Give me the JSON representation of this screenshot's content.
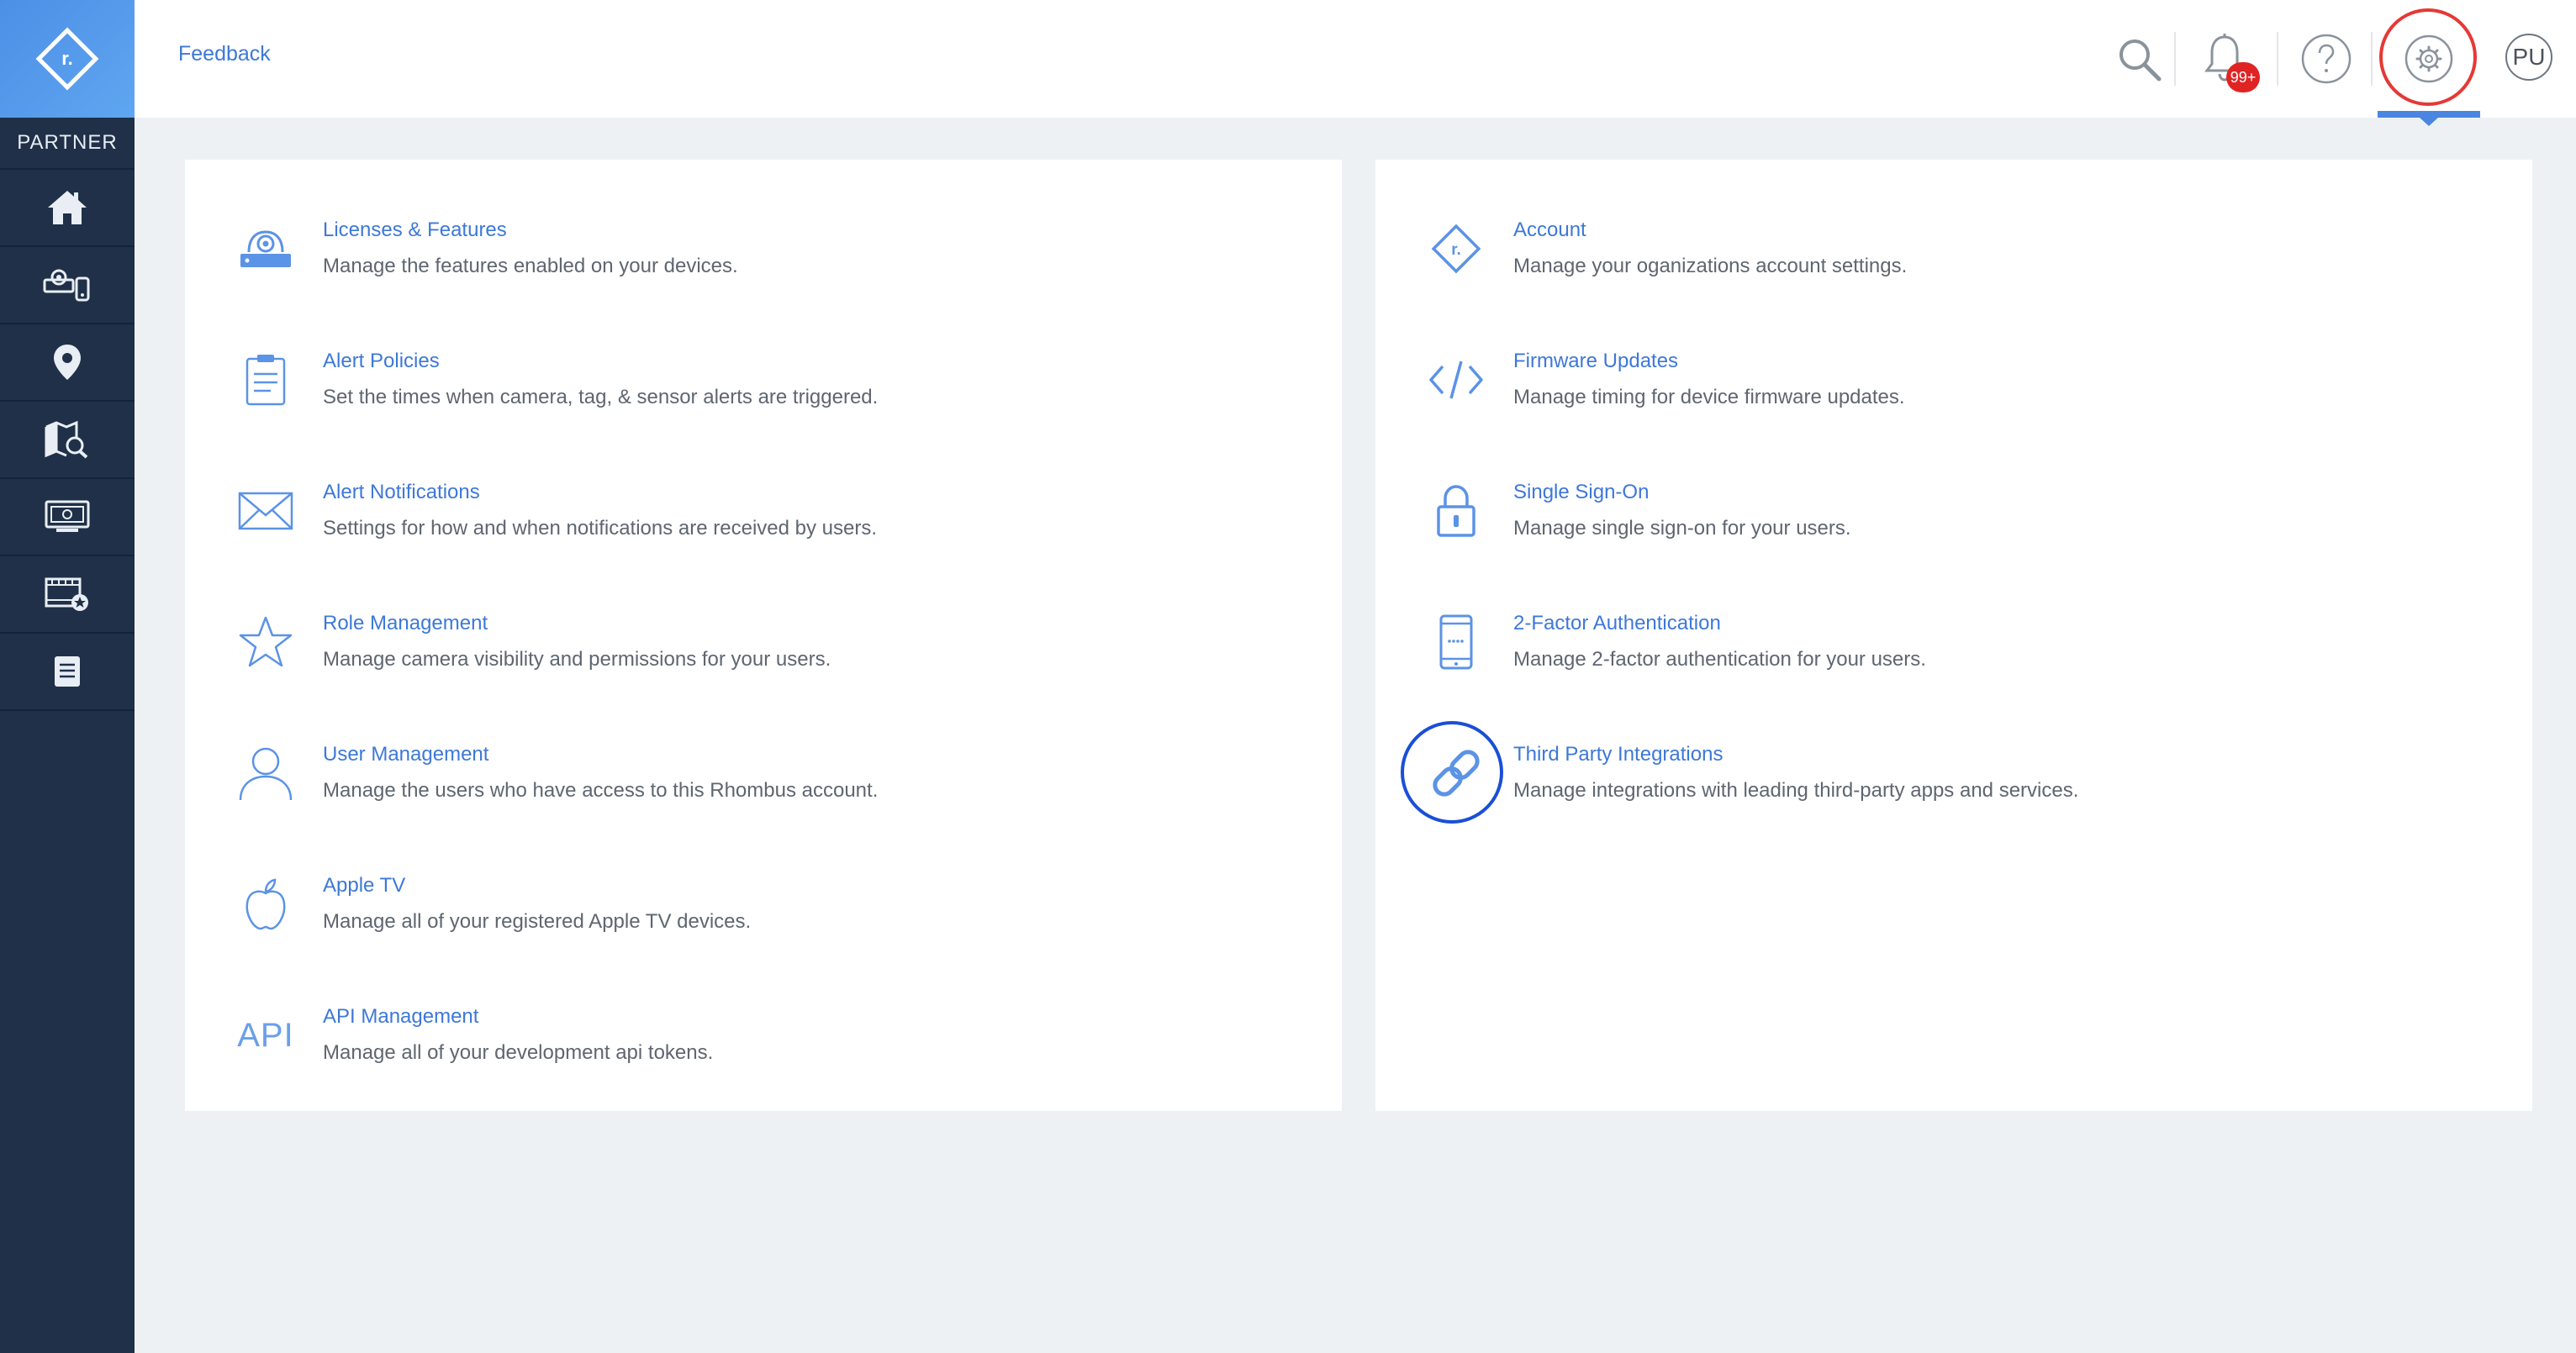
{
  "sidebar": {
    "section_label": "PARTNER",
    "items": [
      {
        "name": "home",
        "icon": "home-icon"
      },
      {
        "name": "devices",
        "icon": "devices-icon"
      },
      {
        "name": "locations",
        "icon": "location-pin-icon"
      },
      {
        "name": "map-search",
        "icon": "map-search-icon"
      },
      {
        "name": "console",
        "icon": "monitor-icon"
      },
      {
        "name": "video-wall",
        "icon": "video-star-icon"
      },
      {
        "name": "reports",
        "icon": "document-icon"
      }
    ]
  },
  "header": {
    "feedback_label": "Feedback",
    "notification_count": "99+",
    "avatar_initials": "PU"
  },
  "settings_left": [
    {
      "title": "Licenses & Features",
      "desc": "Manage the features enabled on your devices.",
      "icon": "camera-device-icon"
    },
    {
      "title": "Alert Policies",
      "desc": "Set the times when camera, tag, & sensor alerts are triggered.",
      "icon": "clipboard-icon"
    },
    {
      "title": "Alert Notifications",
      "desc": "Settings for how and when notifications are received by users.",
      "icon": "envelope-icon"
    },
    {
      "title": "Role Management",
      "desc": "Manage camera visibility and permissions for your users.",
      "icon": "star-icon"
    },
    {
      "title": "User Management",
      "desc": "Manage the users who have access to this Rhombus account.",
      "icon": "user-icon"
    },
    {
      "title": "Apple TV",
      "desc": "Manage all of your registered Apple TV devices.",
      "icon": "apple-icon"
    },
    {
      "title": "API Management",
      "desc": "Manage all of your development api tokens.",
      "icon": "api-icon",
      "icon_text": "API"
    }
  ],
  "settings_right": [
    {
      "title": "Account",
      "desc": "Manage your oganizations account settings.",
      "icon": "rhombus-logo-icon"
    },
    {
      "title": "Firmware Updates",
      "desc": "Manage timing for device firmware updates.",
      "icon": "code-icon"
    },
    {
      "title": "Single Sign-On",
      "desc": "Manage single sign-on for your users.",
      "icon": "lock-icon"
    },
    {
      "title": "2-Factor Authentication",
      "desc": "Manage 2-factor authentication for your users.",
      "icon": "phone-icon"
    },
    {
      "title": "Third Party Integrations",
      "desc": "Manage integrations with leading third-party apps and services.",
      "icon": "link-icon"
    }
  ],
  "colors": {
    "sidebar_bg": "#1f3048",
    "accent_blue": "#3d78d8",
    "icon_blue": "#5b93e6",
    "highlight_red": "#e53935",
    "highlight_blue": "#1a4fd6",
    "badge_red": "#e02424"
  }
}
